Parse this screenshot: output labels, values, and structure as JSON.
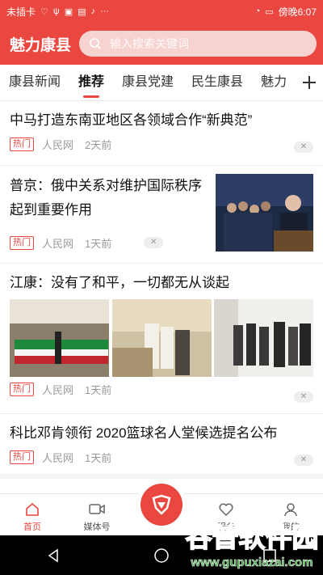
{
  "status_bar": {
    "carrier": "未插卡",
    "time": "傍晚6:07"
  },
  "header": {
    "title": "魅力康县",
    "search_placeholder": "输入搜索关键词"
  },
  "tabs": [
    "康县新闻",
    "推荐",
    "康县党建",
    "民生康县",
    "魅力"
  ],
  "news": [
    {
      "title": "中马打造东南亚地区各领域合作“新典范”",
      "tag": "热门",
      "source": "人民网",
      "time": "2天前"
    },
    {
      "title": "普京：俄中关系对维护国际秩序起到重要作用",
      "tag": "热门",
      "source": "人民网",
      "time": "1天前"
    },
    {
      "title": "江康：没有了和平，一切都无从谈起",
      "tag": "热门",
      "source": "人民网",
      "time": "1天前"
    },
    {
      "title": "科比邓肯领衔 2020篮球名人堂候选提名公布",
      "tag": "热门",
      "source": "人民网",
      "time": "1天前"
    }
  ],
  "bottom_nav": [
    "首页",
    "媒体号",
    "服务",
    "我的"
  ],
  "watermark": {
    "name": "谷普软件园",
    "url": "www.gupuxiazai.com"
  },
  "colors": {
    "accent": "#e9473f"
  }
}
